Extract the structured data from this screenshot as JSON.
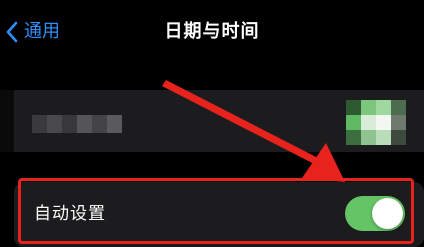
{
  "nav": {
    "back_label": "通用",
    "title": "日期与时间"
  },
  "auto_row": {
    "label": "自动设置",
    "toggle_state": "on"
  },
  "colors": {
    "accent": "#2f8ef7",
    "toggle_on": "#65c466",
    "annotation": "#e8231e",
    "row_background": "#1c1c1e"
  },
  "icons": {
    "back": "chevron-left-icon"
  }
}
